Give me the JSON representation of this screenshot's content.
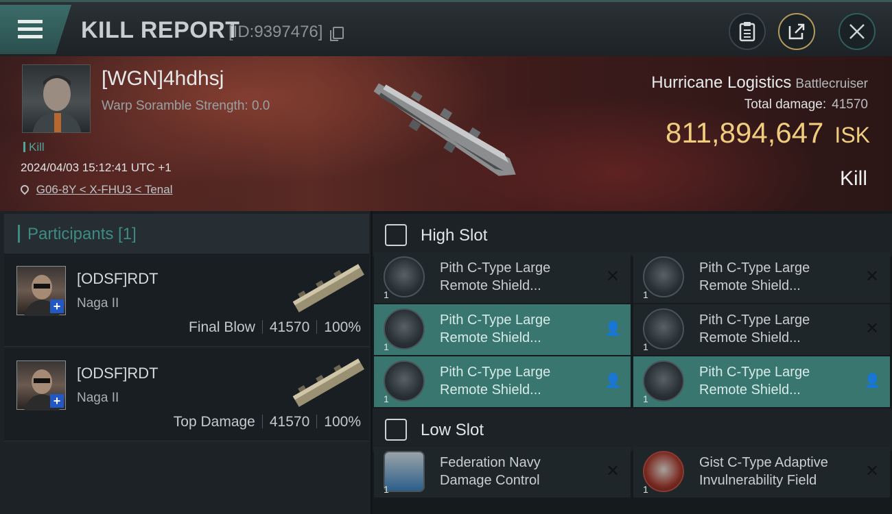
{
  "header": {
    "title": "KILL REPORT",
    "report_id": "[ID:9397476]",
    "menu_icon": "hamburger-menu-icon",
    "clipboard_icon": "clipboard-icon",
    "share_icon": "share-icon",
    "close_icon": "close-icon"
  },
  "victim": {
    "pilot": "[WGN]4hdhsj",
    "warp_scramble": "Warp Soramble Strength: 0.0",
    "type_tag": "Kill",
    "datetime": "2024/04/03 15:12:41 UTC +1",
    "location": "G06-8Y < X-FHU3 < Tenal",
    "ship_name": "Hurricane Logistics",
    "ship_class": "Battlecruiser",
    "total_damage_label": "Total damage:",
    "total_damage": "41570",
    "isk_value": "811,894,647",
    "isk_unit": "ISK",
    "result": "Kill"
  },
  "participants": {
    "title": "Participants [1]",
    "rows": [
      {
        "name": "[ODSF]RDT",
        "ship": "Naga II",
        "role": "Final Blow",
        "damage": "41570",
        "percent": "100%"
      },
      {
        "name": "[ODSF]RDT",
        "ship": "Naga II",
        "role": "Top Damage",
        "damage": "41570",
        "percent": "100%"
      }
    ]
  },
  "fittings": {
    "high_slot": {
      "title": "High Slot",
      "modules": [
        {
          "line1": "Pith C-Type Large",
          "line2": "Remote Shield...",
          "qty": "1",
          "state": "destroyed"
        },
        {
          "line1": "Pith C-Type Large",
          "line2": "Remote Shield...",
          "qty": "1",
          "state": "destroyed"
        },
        {
          "line1": "Pith C-Type Large",
          "line2": "Remote Shield...",
          "qty": "1",
          "state": "dropped"
        },
        {
          "line1": "Pith C-Type Large",
          "line2": "Remote Shield...",
          "qty": "1",
          "state": "destroyed"
        },
        {
          "line1": "Pith C-Type Large",
          "line2": "Remote Shield...",
          "qty": "1",
          "state": "dropped"
        },
        {
          "line1": "Pith C-Type Large",
          "line2": "Remote Shield...",
          "qty": "1",
          "state": "dropped"
        }
      ]
    },
    "low_slot": {
      "title": "Low Slot",
      "modules": [
        {
          "line1": "Federation Navy",
          "line2": "Damage Control",
          "qty": "1",
          "state": "destroyed"
        },
        {
          "line1": "Gist C-Type Adaptive",
          "line2": "Invulnerability Field",
          "qty": "1",
          "state": "destroyed"
        }
      ]
    }
  },
  "colors": {
    "accent": "#3d8c84",
    "isk": "#f0cd7e",
    "active_module": "#39766f"
  }
}
